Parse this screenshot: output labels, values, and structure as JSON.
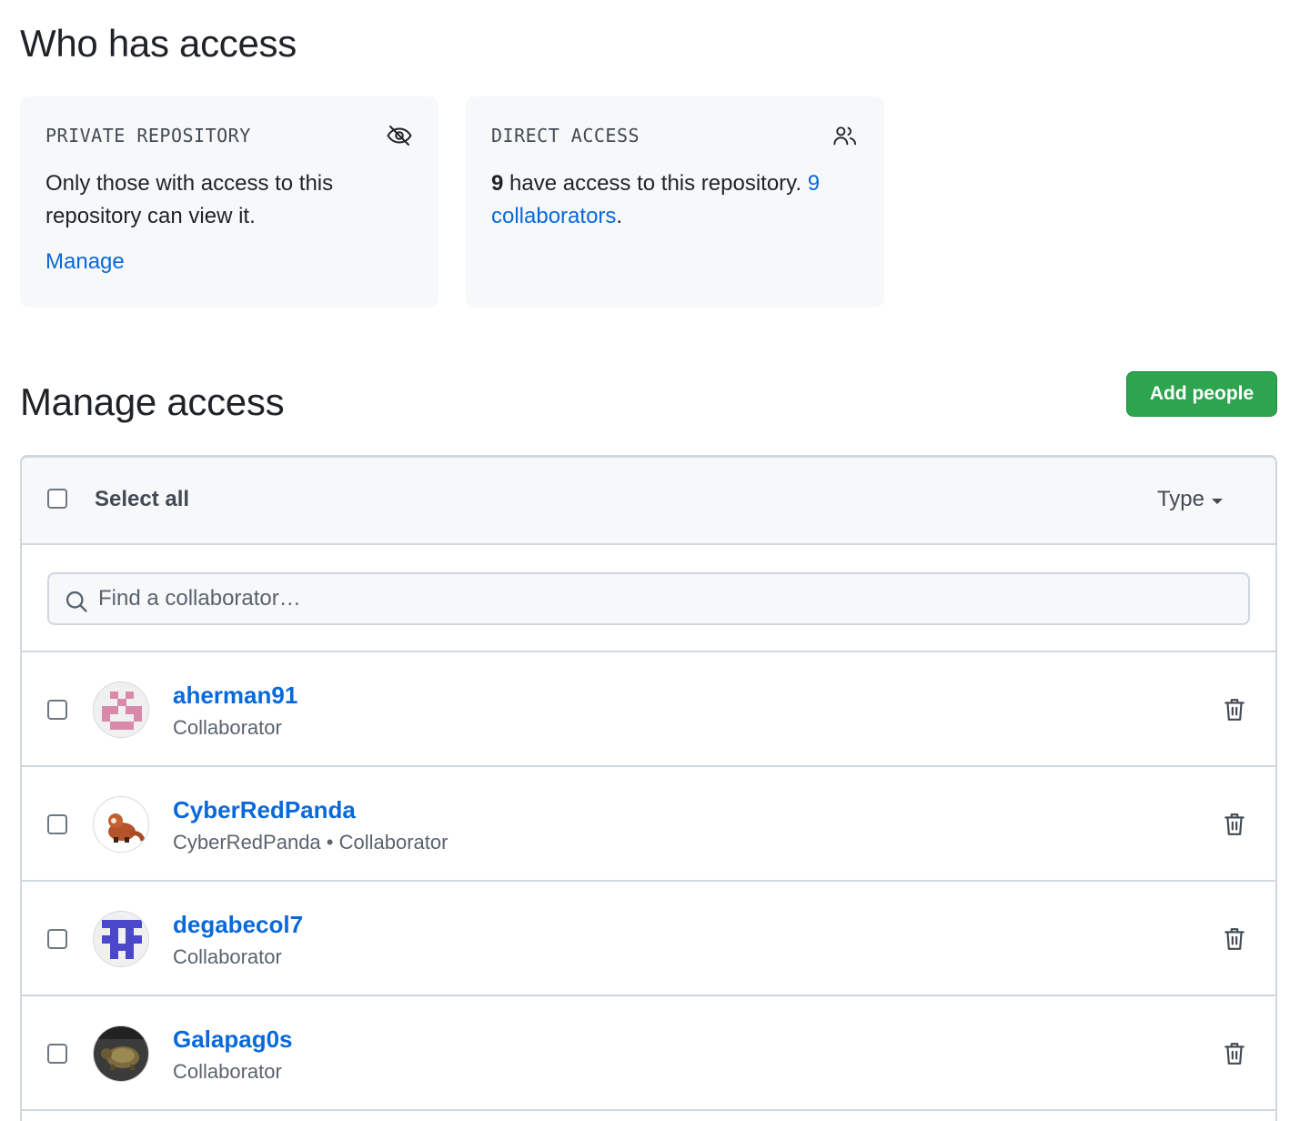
{
  "who": {
    "title": "Who has access",
    "private_card": {
      "label": "PRIVATE REPOSITORY",
      "icon": "eye-closed-icon",
      "text": "Only those with access to this repository can view it.",
      "link": "Manage"
    },
    "direct_card": {
      "label": "DIRECT ACCESS",
      "icon": "people-icon",
      "count": "9",
      "text": " have access to this repository. ",
      "link": "9 collaborators",
      "period": "."
    }
  },
  "manage": {
    "title": "Manage access",
    "add_button": "Add people",
    "select_all": "Select all",
    "type_filter": "Type",
    "search_placeholder": "Find a collaborator…",
    "collaborators": [
      {
        "username": "aherman91",
        "role": "Collaborator",
        "avatar": "identicon-pink"
      },
      {
        "username": "CyberRedPanda",
        "role": "CyberRedPanda • Collaborator",
        "avatar": "red-panda-photo"
      },
      {
        "username": "degabecol7",
        "role": "Collaborator",
        "avatar": "identicon-blue"
      },
      {
        "username": "Galapag0s",
        "role": "Collaborator",
        "avatar": "turtle-photo"
      }
    ]
  },
  "colors": {
    "link": "#0969da",
    "primary_button": "#2da44e",
    "card_bg": "#f6f8fa",
    "border": "#d0d7de"
  }
}
